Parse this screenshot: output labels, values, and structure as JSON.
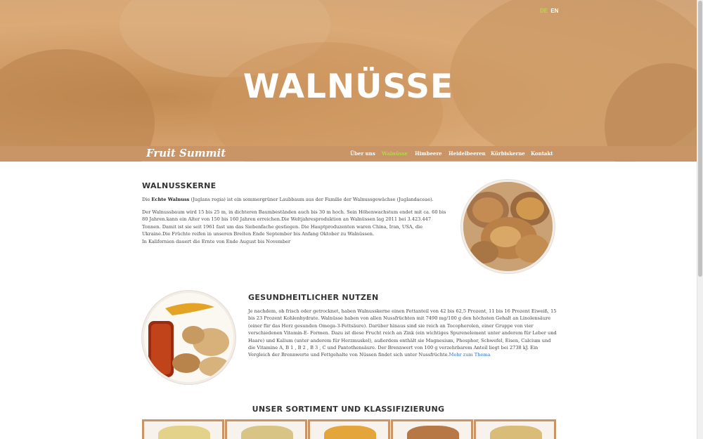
{
  "lang": {
    "de": "DE",
    "en": "EN"
  },
  "hero": {
    "title": "WALNÜSSE"
  },
  "brand": "Fruit Summit",
  "nav": [
    "Über uns",
    "Walnüsse",
    "Himbeere",
    "Heidelbeeren",
    "Kürbiskerne",
    "Kontakt"
  ],
  "nav_active": "Walnüsse",
  "section1": {
    "heading": "WALNUSSKERNE",
    "p1_prefix": "Die ",
    "p1_bold": "Echte Walnuss",
    "p1_rest": " (Juglans regia) ist ein sommergrüner Laubbaum aus der Familie der Walnussgewächse (Juglandaceae).",
    "p2": "Der Walnussbaum wird 15 bis 25 m, in dichteren Baumbeständen auch bis 30 m hoch. Sein Höhenwachstum endet mit ca. 60 bis 80 Jahren.kann ein Alter von 150 bis 160 Jahren erreichen.Die Weltjahresproduktion an Walnüssen lag 2011 bei 3.423.447 Tonnen. Damit ist sie seit 1961 fast um das Siebenfache gestiegen. Die Hauptproduzenten waren China, Iran, USA, die Ukraine.Die Früchte reifen in unseren Breiten Ende September bis Anfang Oktober zu Walnüssen.",
    "p3": "In Kalifornien dauert die Ernte von Ende August bis November"
  },
  "section2": {
    "heading": "GESUNDHEITLICHER NUTZEN",
    "text": "Je nachdem, ob frisch oder getrocknet, haben Walnusskerne einen Fettanteil von 42 bis 62,5 Prozent, 11 bis 16 Prozent Eiweiß, 15 bis 23 Prozent Kohlenhydrate. Walnüsse haben von allen Nussfrüchten mit 7490 mg/100 g den höchsten Gehalt an Linolensäure (einer für das Herz gesunden Omega-3-Fettsäure). Darüber hinaus sind sie reich an Tocopherolen, einer Gruppe von vier verschiedenen Vitamin-E- Formen. Dazu ist diese Frucht reich an Zink (ein wichtiges Spurenelement unter anderem für Leber und Haare) und Kalium (unter anderem für Herzmuskel), außerdem enthält sie Magnesium, Phosphor, Schwefel, Eisen, Calcium und die Vitamine A, B 1 , B 2 , B 3 , C und Pantothensäure. Der Brennwert von 100 g verzehrbarem Anteil liegt bei 2738 kJ. Ein Vergleich der Brennwerte und Fettgehalte von Nüssen findet sich unter Nussfrüchte.",
    "link": "Mehr zum Thema"
  },
  "section3": {
    "heading": "UNSER SORTIMENT UND KLASSIFIZIERUNG"
  },
  "colors": {
    "accent": "#c99466",
    "active_nav": "#b8d64a",
    "link": "#3a6fb0"
  }
}
